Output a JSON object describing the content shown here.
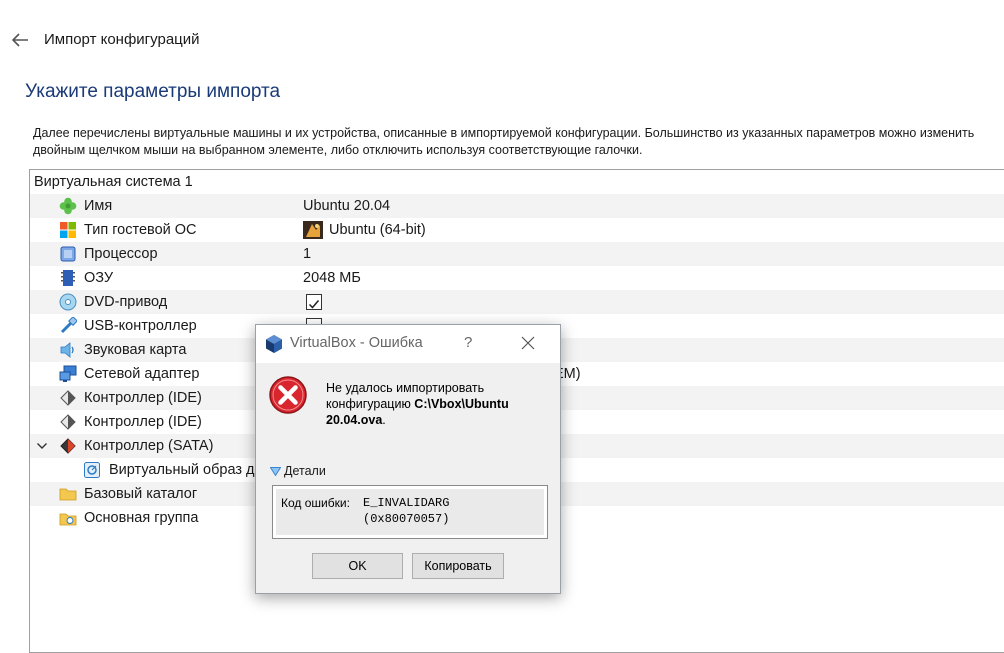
{
  "wizard": {
    "title": "Импорт конфигураций",
    "heading": "Укажите параметры импорта",
    "description": "Далее перечислены виртуальные машины и их устройства, описанные в импортируемой конфигурации. Большинство из указанных параметров можно изменить двойным щелчком мыши на выбранном элементе, либо отключить используя соответствующие галочки."
  },
  "tree": {
    "system": "Виртуальная система 1",
    "items": [
      {
        "label": "Имя",
        "value": "Ubuntu 20.04",
        "icon": "name-icon"
      },
      {
        "label": "Тип гостевой ОС",
        "value": "Ubuntu (64-bit)",
        "icon": "os-type-icon"
      },
      {
        "label": "Процессор",
        "value": "1",
        "icon": "cpu-icon"
      },
      {
        "label": "ОЗУ",
        "value": "2048 МБ",
        "icon": "ram-icon"
      },
      {
        "label": "DVD-привод",
        "checked": true,
        "icon": "dvd-icon"
      },
      {
        "label": "USB-контроллер",
        "checked": true,
        "icon": "usb-icon"
      },
      {
        "label": "Звуковая карта",
        "icon": "audio-icon"
      },
      {
        "label": "Сетевой адаптер",
        "value_tail": "EM)",
        "icon": "network-icon"
      },
      {
        "label": "Контроллер (IDE)",
        "icon": "ide-controller-icon"
      },
      {
        "label": "Контроллер (IDE)",
        "icon": "ide-controller-icon"
      },
      {
        "label": "Контроллер (SATA)",
        "icon": "sata-controller-icon"
      },
      {
        "label": "Виртуальный образ д",
        "icon": "disk-image-icon"
      },
      {
        "label": "Базовый каталог",
        "icon": "folder-icon"
      },
      {
        "label": "Основная группа",
        "icon": "group-icon"
      }
    ]
  },
  "dialog": {
    "title": "VirtualBox - Ошибка",
    "help": "?",
    "message_line1": "Не удалось импортировать",
    "message_line2_prefix": "конфигурацию ",
    "message_path": "C:\\Vbox\\Ubuntu 20.04.ova",
    "message_suffix": ".",
    "details_label": "Детали",
    "error_code_label": "Код ошибки:",
    "error_code": "E_INVALIDARG",
    "error_hex": "(0x80070057)",
    "ok_label": "OK",
    "copy_label": "Копировать"
  },
  "colors": {
    "heading": "#1a3a78",
    "error_red": "#d9262e",
    "dialog_bg": "#f0f0f0"
  }
}
